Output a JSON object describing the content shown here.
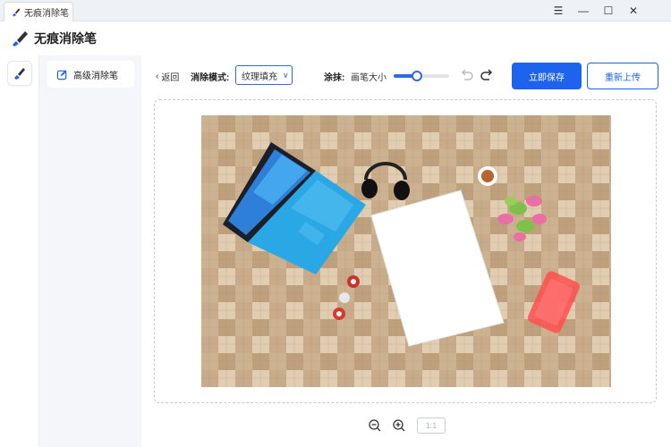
{
  "window": {
    "tab_title": "无痕消除笔",
    "controls": {
      "minimize": "—",
      "restore": "☐",
      "close": "✕",
      "menu": "☰"
    }
  },
  "app": {
    "title": "无痕消除笔"
  },
  "rail": {
    "items": [
      {
        "icon": "brush-icon"
      }
    ]
  },
  "sidebar": {
    "items": [
      {
        "label": "高级消除笔",
        "icon": "edit-icon"
      }
    ]
  },
  "toolbar": {
    "back_label": "返回",
    "mode_label": "消除模式:",
    "mode_value": "纹理填充",
    "smear_label": "涂抹:",
    "brush_size_label": "画笔大小",
    "brush_size_level": 0.42,
    "save_label": "立即保存",
    "reupload_label": "重新上传"
  },
  "zoom": {
    "ratio_label": "1:1"
  },
  "colors": {
    "accent": "#1d63ee",
    "selection_overlay": "#ff4d4d",
    "laptop": "#2aa8e6"
  }
}
